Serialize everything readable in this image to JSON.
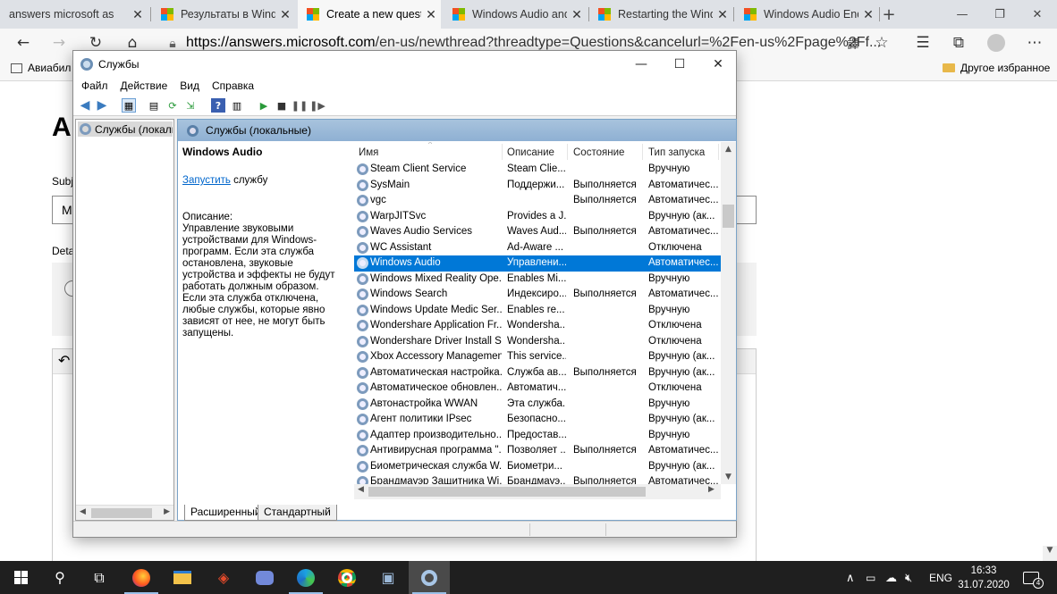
{
  "browser": {
    "tabs": [
      {
        "label": "answers microsoft as",
        "icon": "bing",
        "active": false
      },
      {
        "label": "Результаты в Windo",
        "icon": "microsoft-logo",
        "active": false
      },
      {
        "label": "Create a new questic",
        "icon": "microsoft-logo",
        "active": true
      },
      {
        "label": "Windows Audio and",
        "icon": "microsoft-logo",
        "active": false
      },
      {
        "label": "Restarting the Windc",
        "icon": "microsoft-logo",
        "active": false
      },
      {
        "label": "Windows Audio End",
        "icon": "microsoft-logo",
        "active": false
      }
    ],
    "new_tab": "+",
    "close_glyph": "✕",
    "url_host": "https://answers.microsoft.com",
    "url_rest": "/en-us/newthread?threadtype=Questions&cancelurl=%2Fen-us%2Fpage%2Ff...",
    "favorites": {
      "left_item": "Авиабил",
      "right_item": "Другое избранное"
    }
  },
  "webpage": {
    "heading_letter": "A",
    "subject_label": "Subj",
    "subject_value": "M",
    "details_label": "Deta",
    "undo_glyph": "↶"
  },
  "services": {
    "window_title": "Службы",
    "menu": [
      "Файл",
      "Действие",
      "Вид",
      "Справка"
    ],
    "tree_node": "Службы (локальн",
    "pane_header": "Службы (локальные)",
    "selected_name": "Windows Audio",
    "start_link": "Запустить",
    "start_suffix": " службу",
    "desc_label": "Описание:",
    "desc_text": "Управление звуковыми устройствами для Windows-программ. Если эта служба остановлена, звуковые устройства и эффекты не будут работать должным образом. Если эта служба отключена, любые службы, которые явно зависят от нее, не могут быть запущены.",
    "columns": [
      "Имя",
      "Описание",
      "Состояние",
      "Тип запуска"
    ],
    "rows": [
      {
        "name": "Steam Client Service",
        "desc": "Steam Clie...",
        "state": "",
        "start": "Вручную"
      },
      {
        "name": "SysMain",
        "desc": "Поддержи...",
        "state": "Выполняется",
        "start": "Автоматичес..."
      },
      {
        "name": "vgc",
        "desc": "",
        "state": "Выполняется",
        "start": "Автоматичес..."
      },
      {
        "name": "WarpJITSvc",
        "desc": "Provides a J...",
        "state": "",
        "start": "Вручную (ак..."
      },
      {
        "name": "Waves Audio Services",
        "desc": "Waves Aud...",
        "state": "Выполняется",
        "start": "Автоматичес..."
      },
      {
        "name": "WC Assistant",
        "desc": "Ad-Aware ...",
        "state": "",
        "start": "Отключена"
      },
      {
        "name": "Windows Audio",
        "desc": "Управлени...",
        "state": "",
        "start": "Автоматичес...",
        "selected": true
      },
      {
        "name": "Windows Mixed Reality Ope...",
        "desc": "Enables Mi...",
        "state": "",
        "start": "Вручную"
      },
      {
        "name": "Windows Search",
        "desc": "Индексиро...",
        "state": "Выполняется",
        "start": "Автоматичес..."
      },
      {
        "name": "Windows Update Medic Ser...",
        "desc": "Enables re...",
        "state": "",
        "start": "Вручную"
      },
      {
        "name": "Wondershare Application Fr...",
        "desc": "Wondersha...",
        "state": "",
        "start": "Отключена"
      },
      {
        "name": "Wondershare Driver Install S...",
        "desc": "Wondersha...",
        "state": "",
        "start": "Отключена"
      },
      {
        "name": "Xbox Accessory Managemen...",
        "desc": "This service...",
        "state": "",
        "start": "Вручную (ак..."
      },
      {
        "name": "Автоматическая настройка...",
        "desc": "Служба ав...",
        "state": "Выполняется",
        "start": "Вручную (ак..."
      },
      {
        "name": "Автоматическое обновлен...",
        "desc": "Автоматич...",
        "state": "",
        "start": "Отключена"
      },
      {
        "name": "Автонастройка WWAN",
        "desc": "Эта служба...",
        "state": "",
        "start": "Вручную"
      },
      {
        "name": "Агент политики IPsec",
        "desc": "Безопасно...",
        "state": "",
        "start": "Вручную (ак..."
      },
      {
        "name": "Адаптер производительно...",
        "desc": "Предостав...",
        "state": "",
        "start": "Вручную"
      },
      {
        "name": "Антивирусная программа \"...",
        "desc": "Позволяет ...",
        "state": "Выполняется",
        "start": "Автоматичес..."
      },
      {
        "name": "Биометрическая служба W...",
        "desc": "Биометри...",
        "state": "",
        "start": "Вручную (ак..."
      },
      {
        "name": "Брандмауэр Защитника Wi...",
        "desc": "Брандмауэ...",
        "state": "Выполняется",
        "start": "Автоматичес..."
      }
    ],
    "bottom_tabs": [
      "Расширенный",
      "Стандартный"
    ]
  },
  "taskbar": {
    "lang": "ENG",
    "time": "16:33",
    "date": "31.07.2020",
    "notifications": "4"
  },
  "colors": {
    "selection": "#0078d7",
    "link": "#0066cc",
    "taskbar": "#1f1f1f"
  }
}
